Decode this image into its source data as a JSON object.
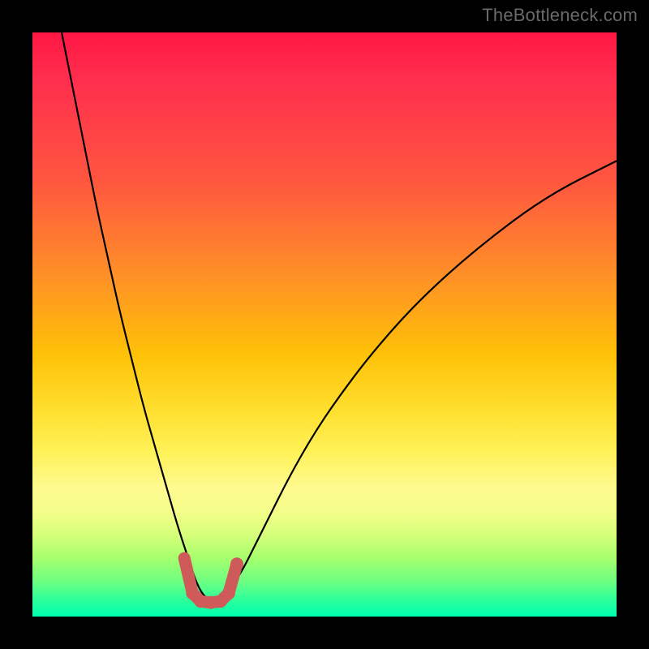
{
  "watermark": "TheBottleneck.com",
  "chart_data": {
    "type": "line",
    "title": "",
    "xlabel": "",
    "ylabel": "",
    "xlim": [
      0,
      100
    ],
    "ylim": [
      0,
      100
    ],
    "grid": false,
    "series": [
      {
        "name": "bottleneck-curve",
        "x": [
          5,
          7,
          9,
          11,
          13,
          15,
          17,
          19,
          21,
          23,
          25,
          27,
          28,
          29,
          30,
          31,
          32,
          33,
          34,
          36,
          38,
          40,
          44,
          48,
          52,
          58,
          66,
          76,
          88,
          100
        ],
        "y": [
          100,
          90,
          80,
          70,
          61,
          52,
          44,
          36,
          29,
          22,
          15,
          9,
          6,
          4,
          3,
          2.5,
          3,
          4,
          5,
          8,
          12,
          16,
          24,
          31,
          37,
          45,
          54,
          63,
          72,
          78
        ]
      }
    ],
    "markers": {
      "name": "highlight-valley",
      "color": "#cf5a5a",
      "points": [
        {
          "x": 26.0,
          "y": 10.0
        },
        {
          "x": 27.4,
          "y": 4.0
        },
        {
          "x": 28.8,
          "y": 2.6
        },
        {
          "x": 30.5,
          "y": 2.4
        },
        {
          "x": 32.2,
          "y": 2.6
        },
        {
          "x": 33.6,
          "y": 4.0
        },
        {
          "x": 35.0,
          "y": 9.0
        }
      ]
    },
    "background_gradient": {
      "top": "#ff1744",
      "mid": "#ffe030",
      "bottom": "#00ffb0"
    }
  }
}
